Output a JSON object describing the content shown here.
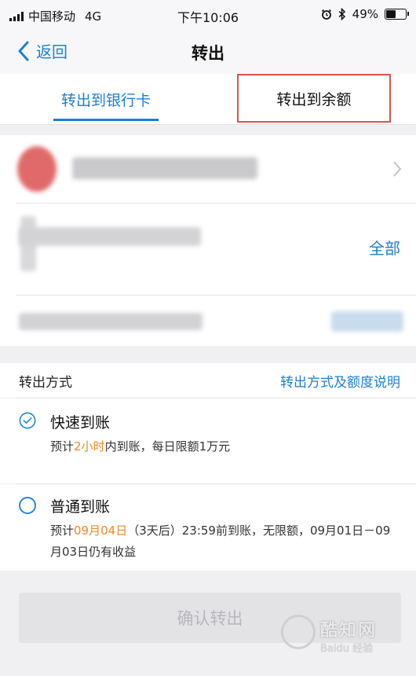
{
  "status_bar": {
    "carrier": "中国移动",
    "network": "4G",
    "time": "下午10:06",
    "battery": "49%",
    "battery_level": 0.49
  },
  "nav": {
    "back_label": "返回",
    "title": "转出"
  },
  "tabs": [
    {
      "label": "转出到银行卡",
      "active": true
    },
    {
      "label": "转出到余额",
      "active": false,
      "highlighted": true
    }
  ],
  "amount": {
    "all_label": "全部"
  },
  "method": {
    "label": "转出方式",
    "link": "转出方式及额度说明",
    "options": [
      {
        "title": "快速到账",
        "checked": true,
        "desc_prefix": "预计",
        "desc_highlight": "2小时",
        "desc_suffix": "内到账，每日限额1万元"
      },
      {
        "title": "普通到账",
        "checked": false,
        "desc_prefix": "预计",
        "desc_highlight": "09月04日",
        "desc_suffix": "（3天后）23:59前到账，无限额，09月01日－09月03日仍有收益"
      }
    ]
  },
  "confirm_button": "确认转出",
  "watermark": {
    "text": "酷知网",
    "sub": "Baidu 经验"
  },
  "colors": {
    "accent": "#1c7fd6",
    "highlight_box": "#d9534f",
    "orange_text": "#f08a24"
  }
}
